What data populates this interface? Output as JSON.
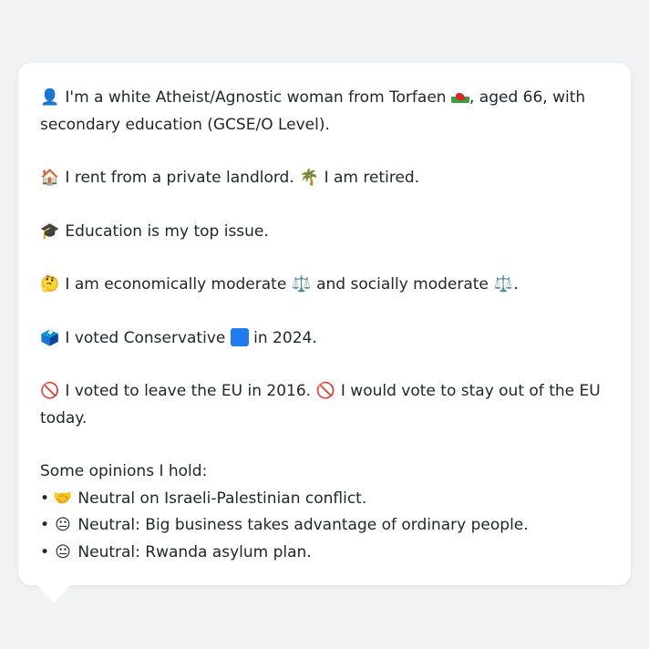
{
  "profile": {
    "intro": {
      "icon": "person-silhouette-icon",
      "icon_glyph": "👤",
      "text_a": "I'm a white Atheist/Agnostic woman from Torfaen",
      "flag_icon": "wales-flag-icon",
      "text_b": ", aged 66, with",
      "text_c": "secondary education (GCSE/O Level)."
    },
    "housing": {
      "house_glyph": "🏠",
      "housing_text": "I rent from a private landlord.",
      "palm_glyph": "🌴",
      "work_text": "I am retired."
    },
    "issue": {
      "glyph": "🎓",
      "text": "Education is my top issue."
    },
    "ideology": {
      "glyph": "🤔",
      "text_a": "I am economically moderate",
      "scale_glyph": "⚖️",
      "text_b": "and socially moderate",
      "text_end": "."
    },
    "vote": {
      "glyph": "🗳️",
      "text_a": "I voted Conservative",
      "party_color": "#1e7bf0",
      "text_b": "in 2024."
    },
    "brexit": {
      "glyph": "🚫",
      "text_a": "I voted to leave the EU in 2016.",
      "text_b": "I would vote to stay out of the EU",
      "text_c": "today."
    },
    "opinions": {
      "heading": "Some opinions I hold:",
      "bullet": "•",
      "items": [
        {
          "glyph": "🤝",
          "text": "Neutral on Israeli-Palestinian conflict."
        },
        {
          "glyph": "😐",
          "text": "Neutral: Big business takes advantage of ordinary people."
        },
        {
          "glyph": "😐",
          "text": "Neutral: Rwanda asylum plan."
        }
      ]
    }
  }
}
